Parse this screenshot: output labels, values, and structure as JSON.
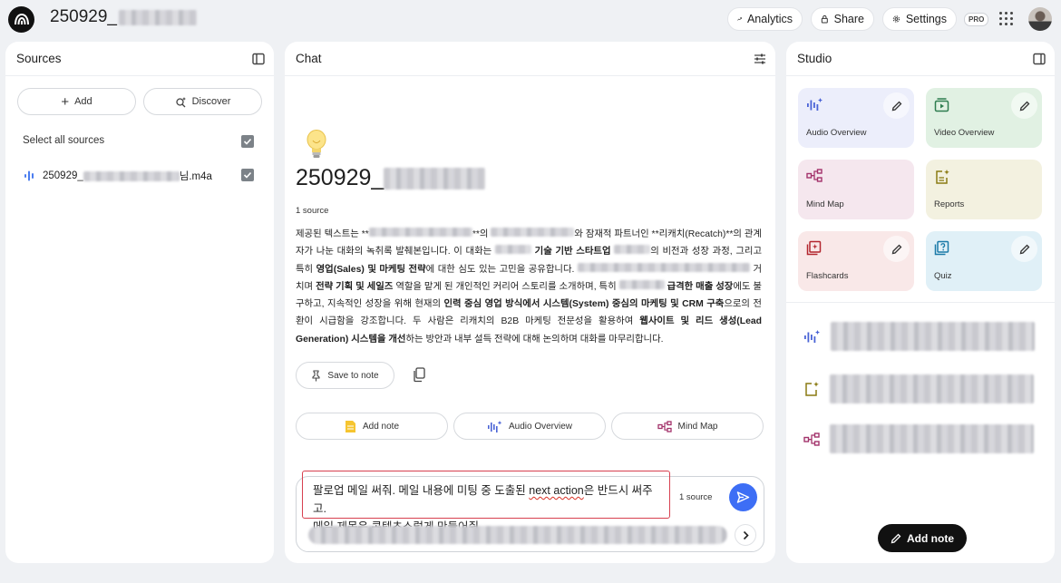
{
  "app": {
    "notebook_title": "250929_"
  },
  "topbar": {
    "analytics": "Analytics",
    "share": "Share",
    "settings": "Settings",
    "pro_badge": "PRO"
  },
  "sources": {
    "title": "Sources",
    "add": "Add",
    "discover": "Discover",
    "select_all": "Select all sources",
    "file_prefix": "250929_",
    "file_suffix": "님.m4a"
  },
  "chat": {
    "title": "Chat",
    "doc_title": "250929_",
    "source_count": "1 source",
    "summary": {
      "s1": "제공된 텍스트는 **",
      "s2": "**의 ",
      "s3": "와 잠재적 파트너인 **리캐치(Recatch)**의 관계자가 나눈 대화의 녹취록 발췌본입니다. 이 대화는 ",
      "s4": "기술 기반 스타트업",
      "s5": "의 비전과 성장 과정, 그리고 특히 ",
      "s6": "영업(Sales) 및 마케팅 전략",
      "s7": "에 대한 심도 있는 고민을 공유합니다. ",
      "s8": "거치며 ",
      "s9": "전략 기획 및 세일즈",
      "s10": " 역할을 맡게 된 개인적인 커리어 스토리를 소개하며, 특히 ",
      "s11": "급격한 매출 성장",
      "s12": "에도 불구하고, 지속적인 성장을 위해 현재의 ",
      "s13": "인력 중심 영업 방식에서 시스템(System) 중심의 마케팅 및 CRM 구축",
      "s14": "으로의 전환이 시급함을 강조합니다. 두 사람은 리캐치의 B2B 마케팅 전문성을 활용하여 ",
      "s15": "웹사이트 및 리드 생성(Lead Generation) 시스템을 개선",
      "s16": "하는 방안과 내부 설득 전략에 대해 논의하며 대화를 마무리합니다."
    },
    "save_to_note": "Save to note",
    "suggestions": [
      "Add note",
      "Audio Overview",
      "Mind Map"
    ],
    "input_line1_a": "팔로업 메일 써줘. 메일 내용에 미팅 중 도출된 ",
    "input_line1_b": "next action",
    "input_line1_c": "은 반드시 써주고.",
    "input_line2_a": "메일 ",
    "input_line2_b": "제목은",
    "input_line2_c": " 콘텐츠스럽게 만들어줘.",
    "input_source_count": "1 source"
  },
  "studio": {
    "title": "Studio",
    "tiles": [
      {
        "label": "Audio Overview",
        "bg": "#eceefb"
      },
      {
        "label": "Video Overview",
        "bg": "#e1f1e3"
      },
      {
        "label": "Mind Map",
        "bg": "#f5e7ee"
      },
      {
        "label": "Reports",
        "bg": "#f3f1e0"
      },
      {
        "label": "Flashcards",
        "bg": "#f9e8e8"
      },
      {
        "label": "Quiz",
        "bg": "#e0f0f7"
      }
    ],
    "add_note": "Add note"
  },
  "colors": {
    "accent_blue": "#3d6ef5",
    "highlight_red": "#d7404f",
    "audio_icon": "#4a63d6",
    "video_icon": "#2e7d4f",
    "mindmap_icon": "#a3336b",
    "reports_icon": "#8a7a12",
    "flashcards_icon": "#b3262e",
    "quiz_icon": "#1a7aa8"
  }
}
